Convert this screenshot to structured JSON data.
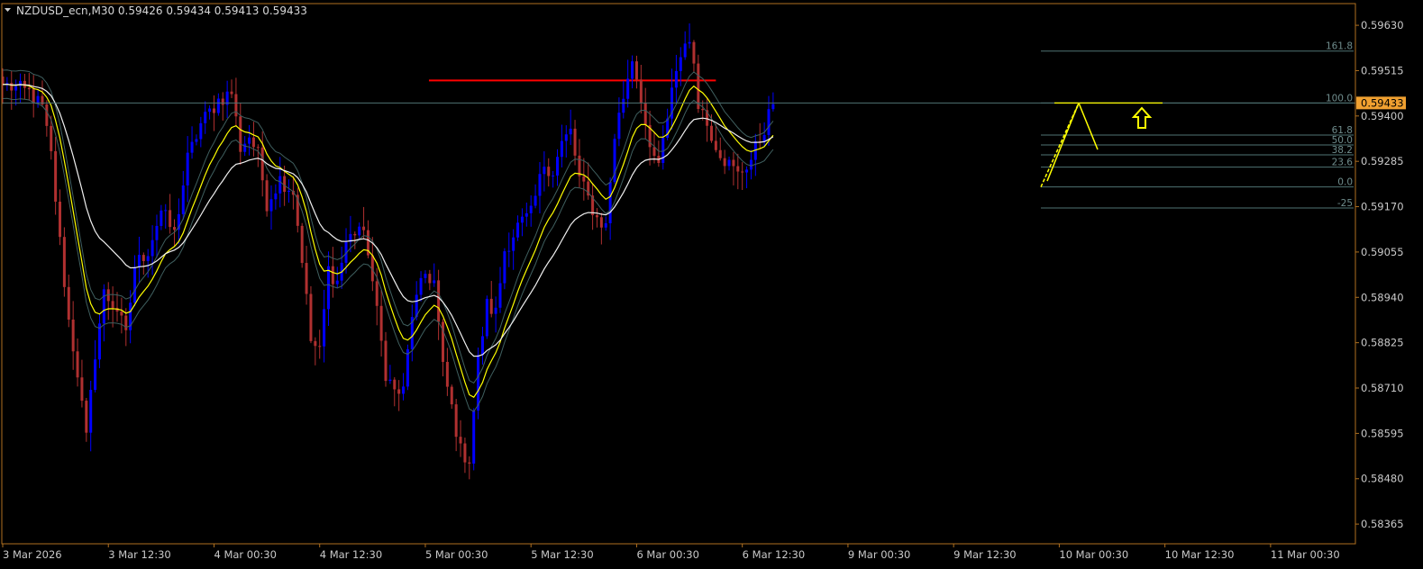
{
  "header": {
    "title_text": "NZDUSD_ecn,M30  0.59426 0.59434 0.59413 0.59433"
  },
  "chart_data": {
    "type": "candlestick",
    "symbol": "NZDUSD_ecn",
    "timeframe": "M30",
    "ohlc_last": {
      "open": 0.59426,
      "high": 0.59434,
      "low": 0.59413,
      "close": 0.59433
    },
    "current_price": 0.59433,
    "current_price_label": "0.59433",
    "price_ticks": [
      0.5963,
      0.59515,
      0.594,
      0.59285,
      0.5917,
      0.59055,
      0.5894,
      0.58825,
      0.5871,
      0.58595,
      0.5848,
      0.58365
    ],
    "price_tick_labels": [
      "0.59630",
      "0.59515",
      "0.59400",
      "0.59285",
      "0.59170",
      "0.59055",
      "0.58940",
      "0.58825",
      "0.58710",
      "0.58595",
      "0.58480",
      "0.58365"
    ],
    "ylim": [
      0.58315,
      0.59685
    ],
    "time_labels": [
      "3 Mar 2026",
      "3 Mar 12:30",
      "4 Mar 00:30",
      "4 Mar 12:30",
      "5 Mar 00:30",
      "5 Mar 12:30",
      "6 Mar 00:30",
      "6 Mar 12:30",
      "9 Mar 00:30",
      "9 Mar 12:30",
      "10 Mar 00:30",
      "10 Mar 12:30",
      "11 Mar 00:30"
    ],
    "bar_count": 196,
    "bar_step": 24,
    "close_anchors": [
      [
        0,
        0.5948
      ],
      [
        6,
        0.5946
      ],
      [
        9,
        0.5942
      ],
      [
        11,
        0.593
      ],
      [
        13,
        0.5908
      ],
      [
        15,
        0.5888
      ],
      [
        17,
        0.5875
      ],
      [
        19,
        0.5858
      ],
      [
        21,
        0.588
      ],
      [
        23,
        0.5895
      ],
      [
        26,
        0.5891
      ],
      [
        28,
        0.5884
      ],
      [
        30,
        0.5902
      ],
      [
        33,
        0.5906
      ],
      [
        36,
        0.5916
      ],
      [
        39,
        0.591
      ],
      [
        42,
        0.5929
      ],
      [
        45,
        0.5938
      ],
      [
        49,
        0.5944
      ],
      [
        52,
        0.5946
      ],
      [
        54,
        0.5932
      ],
      [
        56,
        0.5935
      ],
      [
        58,
        0.593
      ],
      [
        60,
        0.5918
      ],
      [
        63,
        0.5924
      ],
      [
        66,
        0.5921
      ],
      [
        68,
        0.5904
      ],
      [
        70,
        0.5883
      ],
      [
        72,
        0.588
      ],
      [
        74,
        0.5901
      ],
      [
        76,
        0.5898
      ],
      [
        78,
        0.5908
      ],
      [
        81,
        0.5912
      ],
      [
        83,
        0.5906
      ],
      [
        85,
        0.589
      ],
      [
        87,
        0.5875
      ],
      [
        89,
        0.587
      ],
      [
        91,
        0.587
      ],
      [
        93,
        0.589
      ],
      [
        96,
        0.59
      ],
      [
        98,
        0.5898
      ],
      [
        100,
        0.5876
      ],
      [
        102,
        0.5866
      ],
      [
        104,
        0.5855
      ],
      [
        106,
        0.5853
      ],
      [
        108,
        0.5878
      ],
      [
        110,
        0.5892
      ],
      [
        112,
        0.589
      ],
      [
        114,
        0.5906
      ],
      [
        117,
        0.5912
      ],
      [
        120,
        0.5915
      ],
      [
        123,
        0.5928
      ],
      [
        125,
        0.5926
      ],
      [
        127,
        0.5933
      ],
      [
        129,
        0.5936
      ],
      [
        131,
        0.5924
      ],
      [
        133,
        0.5919
      ],
      [
        135,
        0.5914
      ],
      [
        137,
        0.5912
      ],
      [
        139,
        0.5935
      ],
      [
        141,
        0.5945
      ],
      [
        143,
        0.5955
      ],
      [
        145,
        0.5945
      ],
      [
        147,
        0.593
      ],
      [
        149,
        0.5928
      ],
      [
        151,
        0.5938
      ],
      [
        152,
        0.5948
      ],
      [
        154,
        0.5955
      ],
      [
        155,
        0.596
      ],
      [
        157,
        0.5954
      ],
      [
        158,
        0.5944
      ],
      [
        160,
        0.5938
      ],
      [
        162,
        0.5933
      ],
      [
        164,
        0.5929
      ],
      [
        167,
        0.5925
      ],
      [
        170,
        0.5929
      ],
      [
        173,
        0.5937
      ],
      [
        175,
        0.5943
      ]
    ],
    "moving_averages": [
      {
        "period": 12,
        "color": "#ffff00",
        "width": 1.2
      },
      {
        "period": 12,
        "offset": 0.00036,
        "color": "#3f5f5f",
        "width": 1
      },
      {
        "period": 12,
        "offset": -0.00036,
        "color": "#3f5f5f",
        "width": 1
      },
      {
        "period": 26,
        "color": "#f0f0f0",
        "width": 1.2
      }
    ],
    "drawings": {
      "resistance_line": {
        "price": 0.5949,
        "from_time": "5 Mar 00:30",
        "to_bar": 162,
        "color": "#ff0000"
      },
      "fibonacci": {
        "anchor_low": 0.5922,
        "anchor_high": 0.59433,
        "levels": [
          "161.8",
          "100.0",
          "61.8",
          "50.0",
          "38.2",
          "23.6",
          "0.0",
          "-25"
        ],
        "color": "#4f7373"
      },
      "pattern_lines": {
        "color": "#ffff00"
      },
      "up_arrow": {
        "color": "#ffff00"
      }
    },
    "colors": {
      "background": "#000000",
      "frame": "#b07020",
      "bull": "#0000ff",
      "bear": "#b03030",
      "price_label_bg": "#f0a030"
    }
  }
}
